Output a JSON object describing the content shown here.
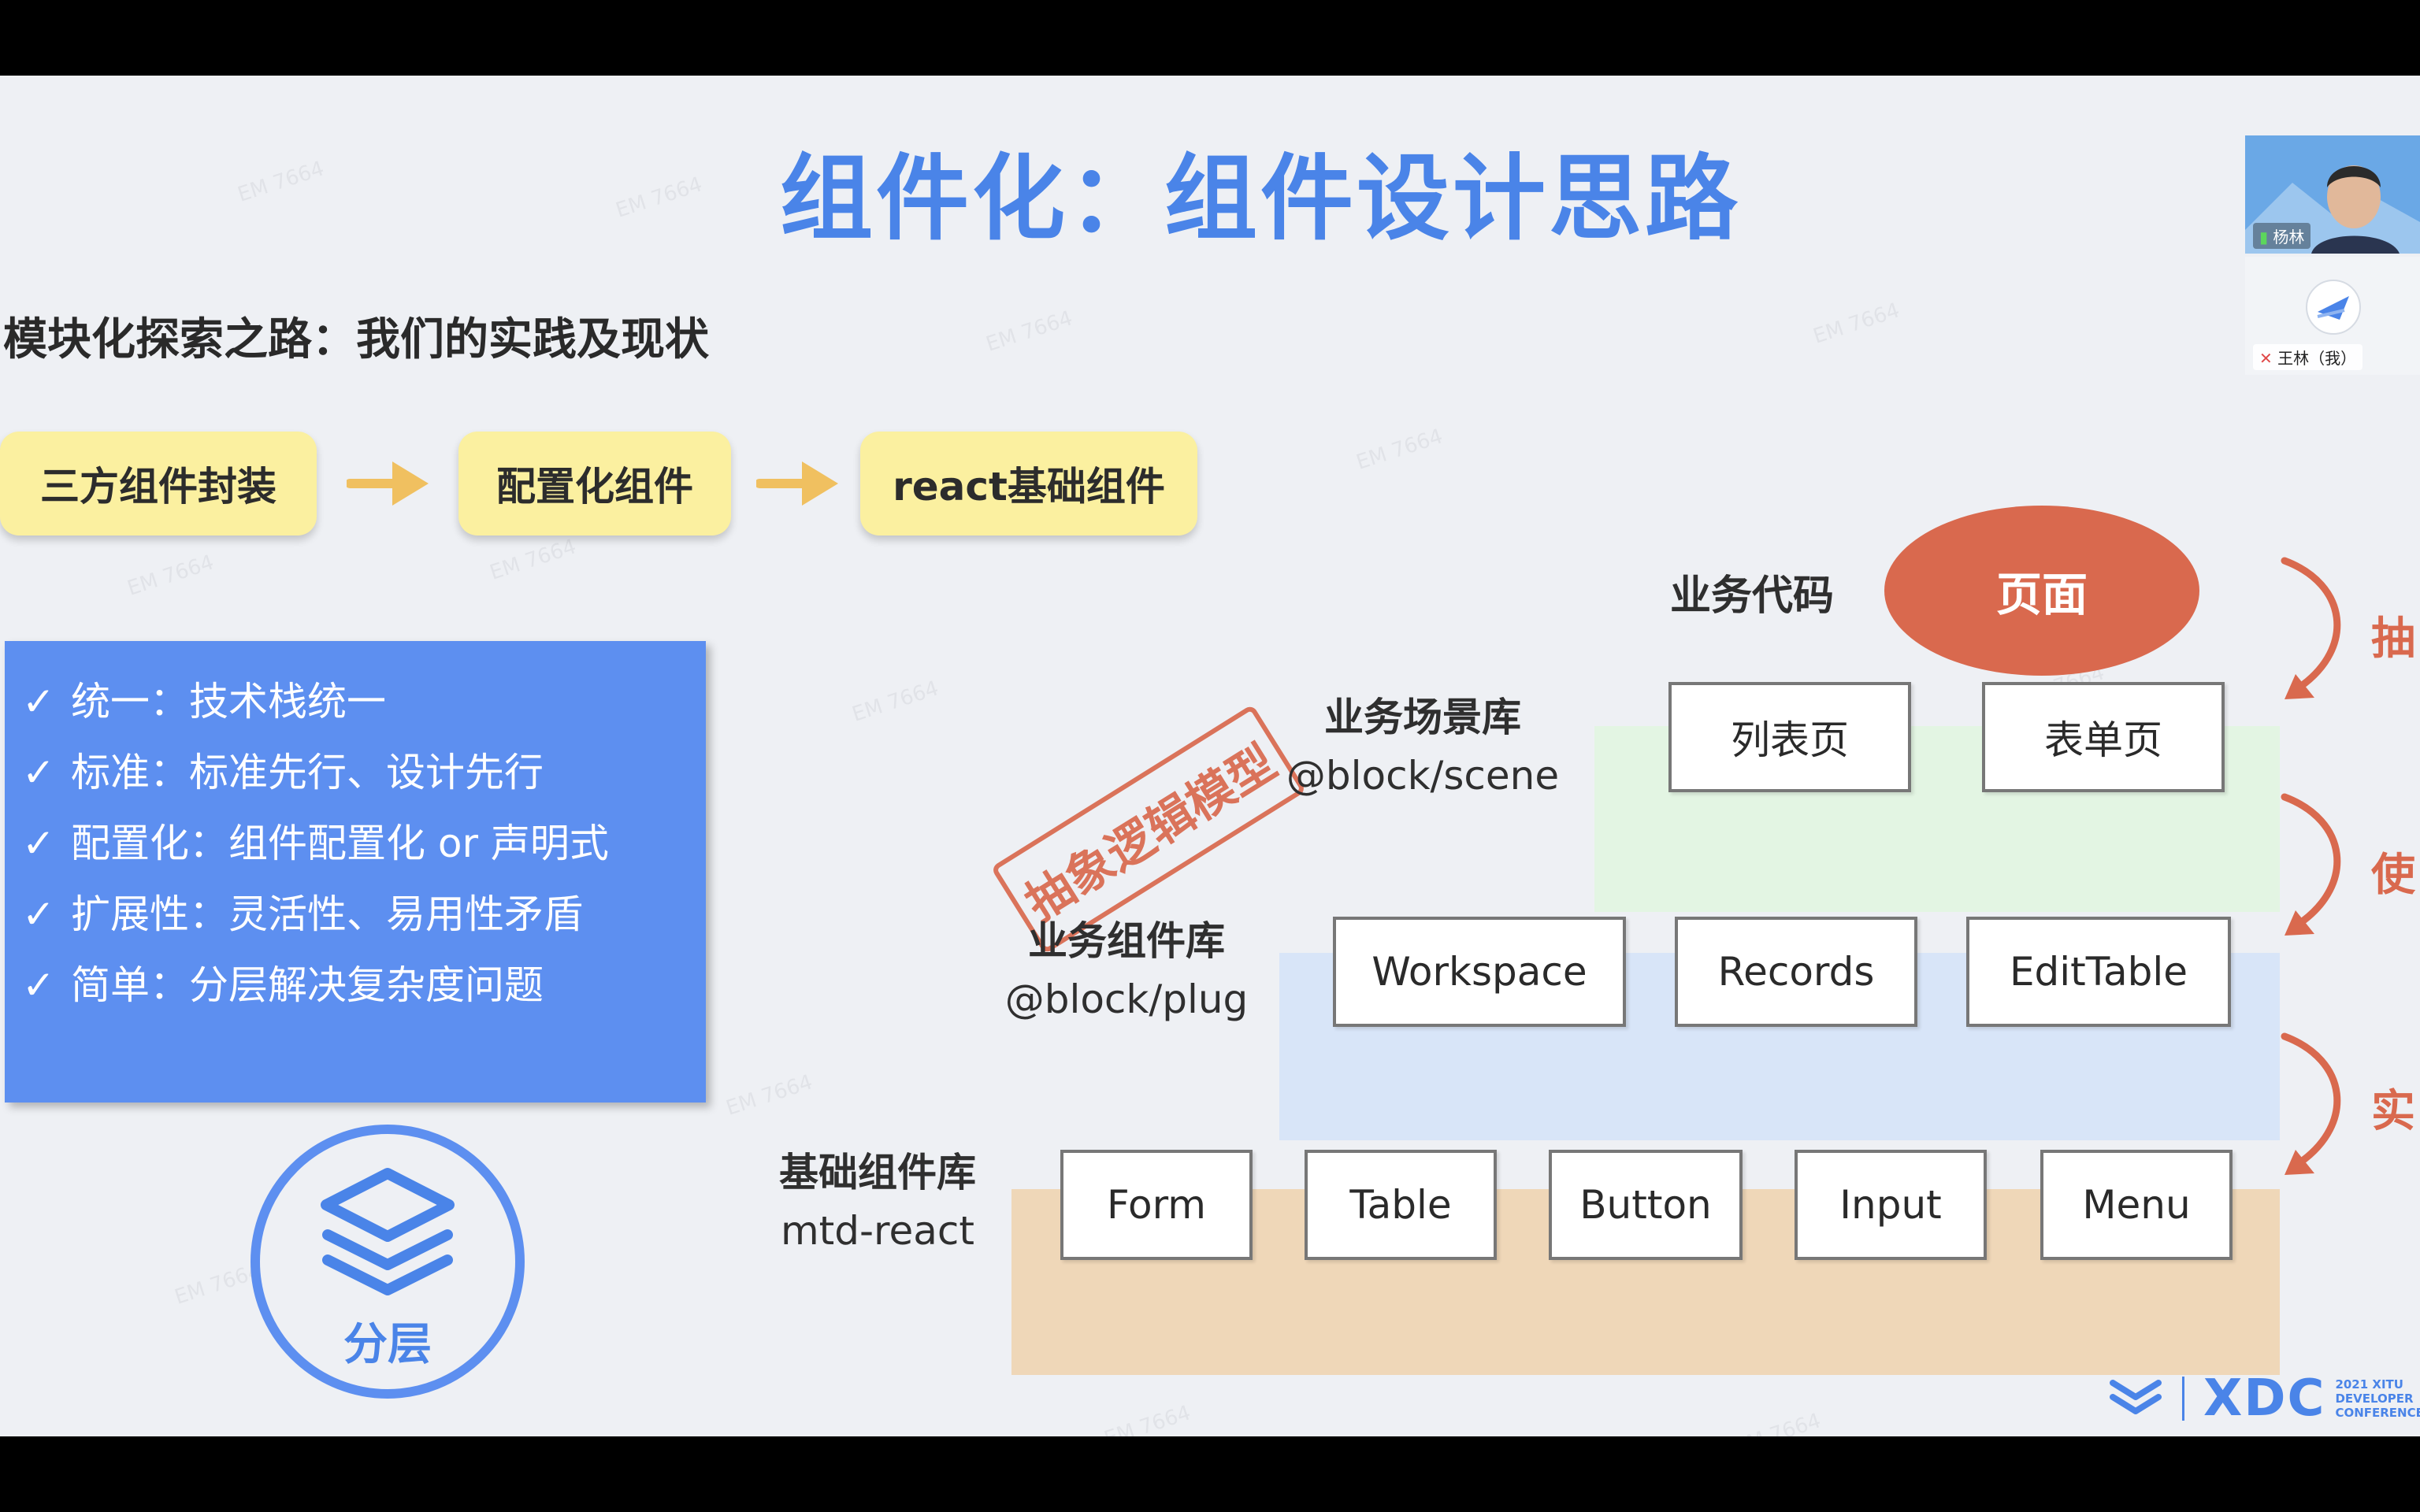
{
  "slide": {
    "title": "组件化：组件设计思路",
    "subtitle": "模块化探索之路：我们的实践及现状",
    "watermark": "EM 7664",
    "flow": [
      "三方组件封装",
      "配置化组件",
      "react基础组件"
    ],
    "principles": [
      "统一：技术栈统一",
      "标准：标准先行、设计先行",
      "配置化：组件配置化 or 声明式",
      "扩展性：灵活性、易用性矛盾",
      "简单：分层解决复杂度问题"
    ],
    "check_mark": "✓",
    "layer_label": "分层",
    "stamp_text": "抽象逻辑模型",
    "code_label": "业务代码",
    "page_label": "页面",
    "scene_lib": {
      "name": "业务场景库",
      "package": "@block/scene",
      "items": [
        "列表页",
        "表单页"
      ]
    },
    "plug_lib": {
      "name": "业务组件库",
      "package": "@block/plug",
      "items": [
        "Workspace",
        "Records",
        "EditTable"
      ]
    },
    "base_lib": {
      "name": "基础组件库",
      "package": "mtd-react",
      "items": [
        "Form",
        "Table",
        "Button",
        "Input",
        "Menu"
      ]
    },
    "side_labels": [
      "抽",
      "使",
      "实"
    ],
    "logo": {
      "text": "XDC",
      "tagline": [
        "2021 XITU",
        "DEVELOPER",
        "CONFERENCE"
      ]
    }
  },
  "participants": [
    {
      "name": "杨林"
    },
    {
      "name": "王林（我）"
    }
  ],
  "colors": {
    "title_blue": "#4a84e8",
    "panel_blue": "#5d8ff0",
    "accent_orange": "#d9694e",
    "flow_yellow": "#fbf0a0",
    "arrow_gold": "#f0c060"
  }
}
